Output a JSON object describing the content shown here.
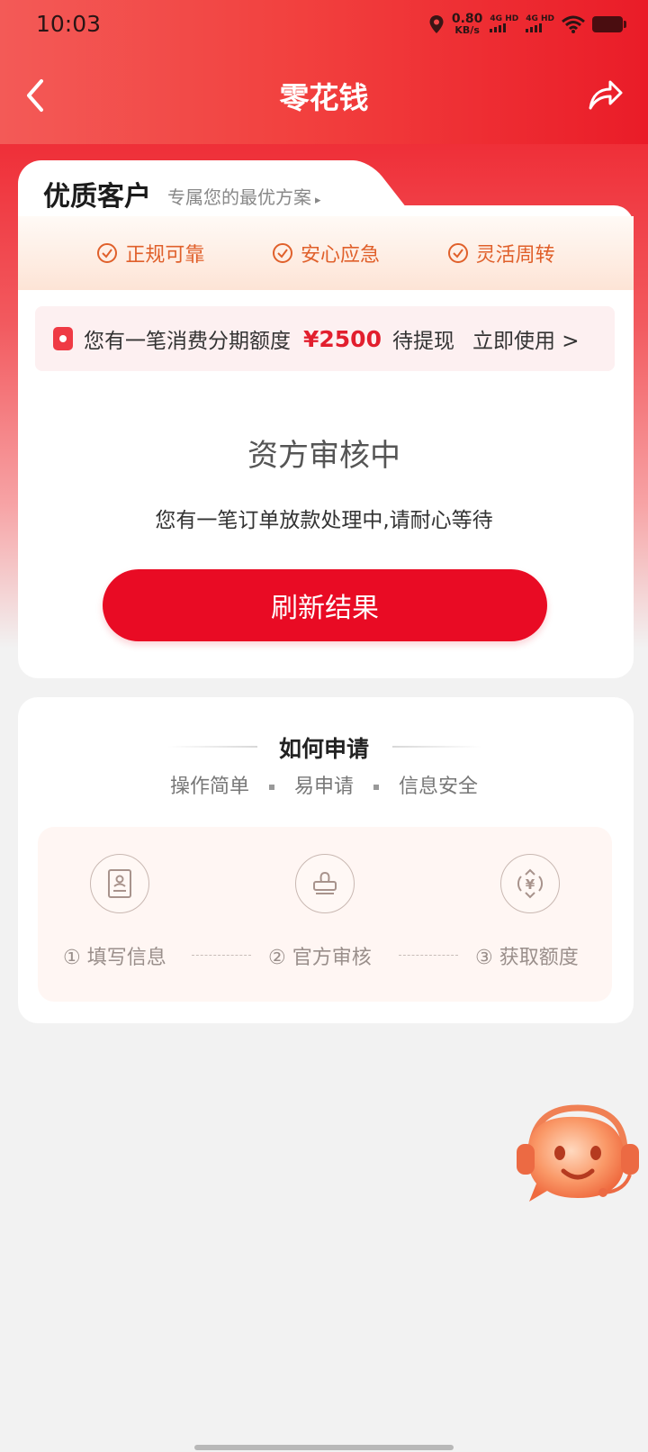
{
  "status_bar": {
    "time": "10:03",
    "speed_value": "0.80",
    "speed_unit": "KB/s",
    "network1": "4G HD",
    "network2": "4G HD"
  },
  "nav": {
    "title": "零花钱"
  },
  "vip": {
    "title": "优质客户",
    "subtitle": "专属您的最优方案",
    "arrow": "▸"
  },
  "features": [
    "正规可靠",
    "安心应急",
    "灵活周转"
  ],
  "quota": {
    "text": "您有一笔消费分期额度",
    "amount": "¥2500",
    "status": "待提现",
    "action": "立即使用 >"
  },
  "review": {
    "title": "资方审核中",
    "desc": "您有一笔订单放款处理中,请耐心等待",
    "button": "刷新结果"
  },
  "how": {
    "title": "如何申请",
    "tags": [
      "操作简单",
      "易申请",
      "信息安全"
    ],
    "steps": [
      "① 填写信息",
      "② 官方审核",
      "③ 获取额度"
    ]
  },
  "colors": {
    "brand_red": "#e90b24",
    "accent_orange": "#e0602b"
  }
}
